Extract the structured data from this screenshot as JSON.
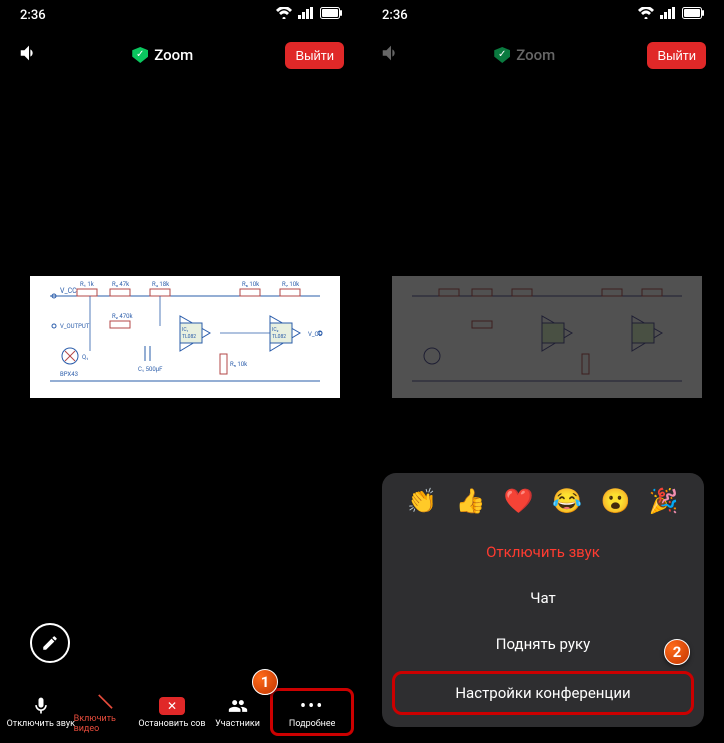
{
  "status": {
    "time": "2:36"
  },
  "header": {
    "app_name": "Zoom",
    "leave_label": "Выйти"
  },
  "bottom": {
    "mute": "Отключить звук",
    "video": "Включить видео",
    "stopshare": "Остановить сов",
    "participants": "Участники",
    "more": "Подробнее"
  },
  "menu": {
    "mute_all": "Отключить звук",
    "chat": "Чат",
    "raise_hand": "Поднять руку",
    "meeting_settings": "Настройки конференции",
    "emojis": [
      "👏",
      "👍",
      "❤️",
      "😂",
      "😮",
      "🎉"
    ]
  },
  "callouts": {
    "one": "1",
    "two": "2"
  }
}
